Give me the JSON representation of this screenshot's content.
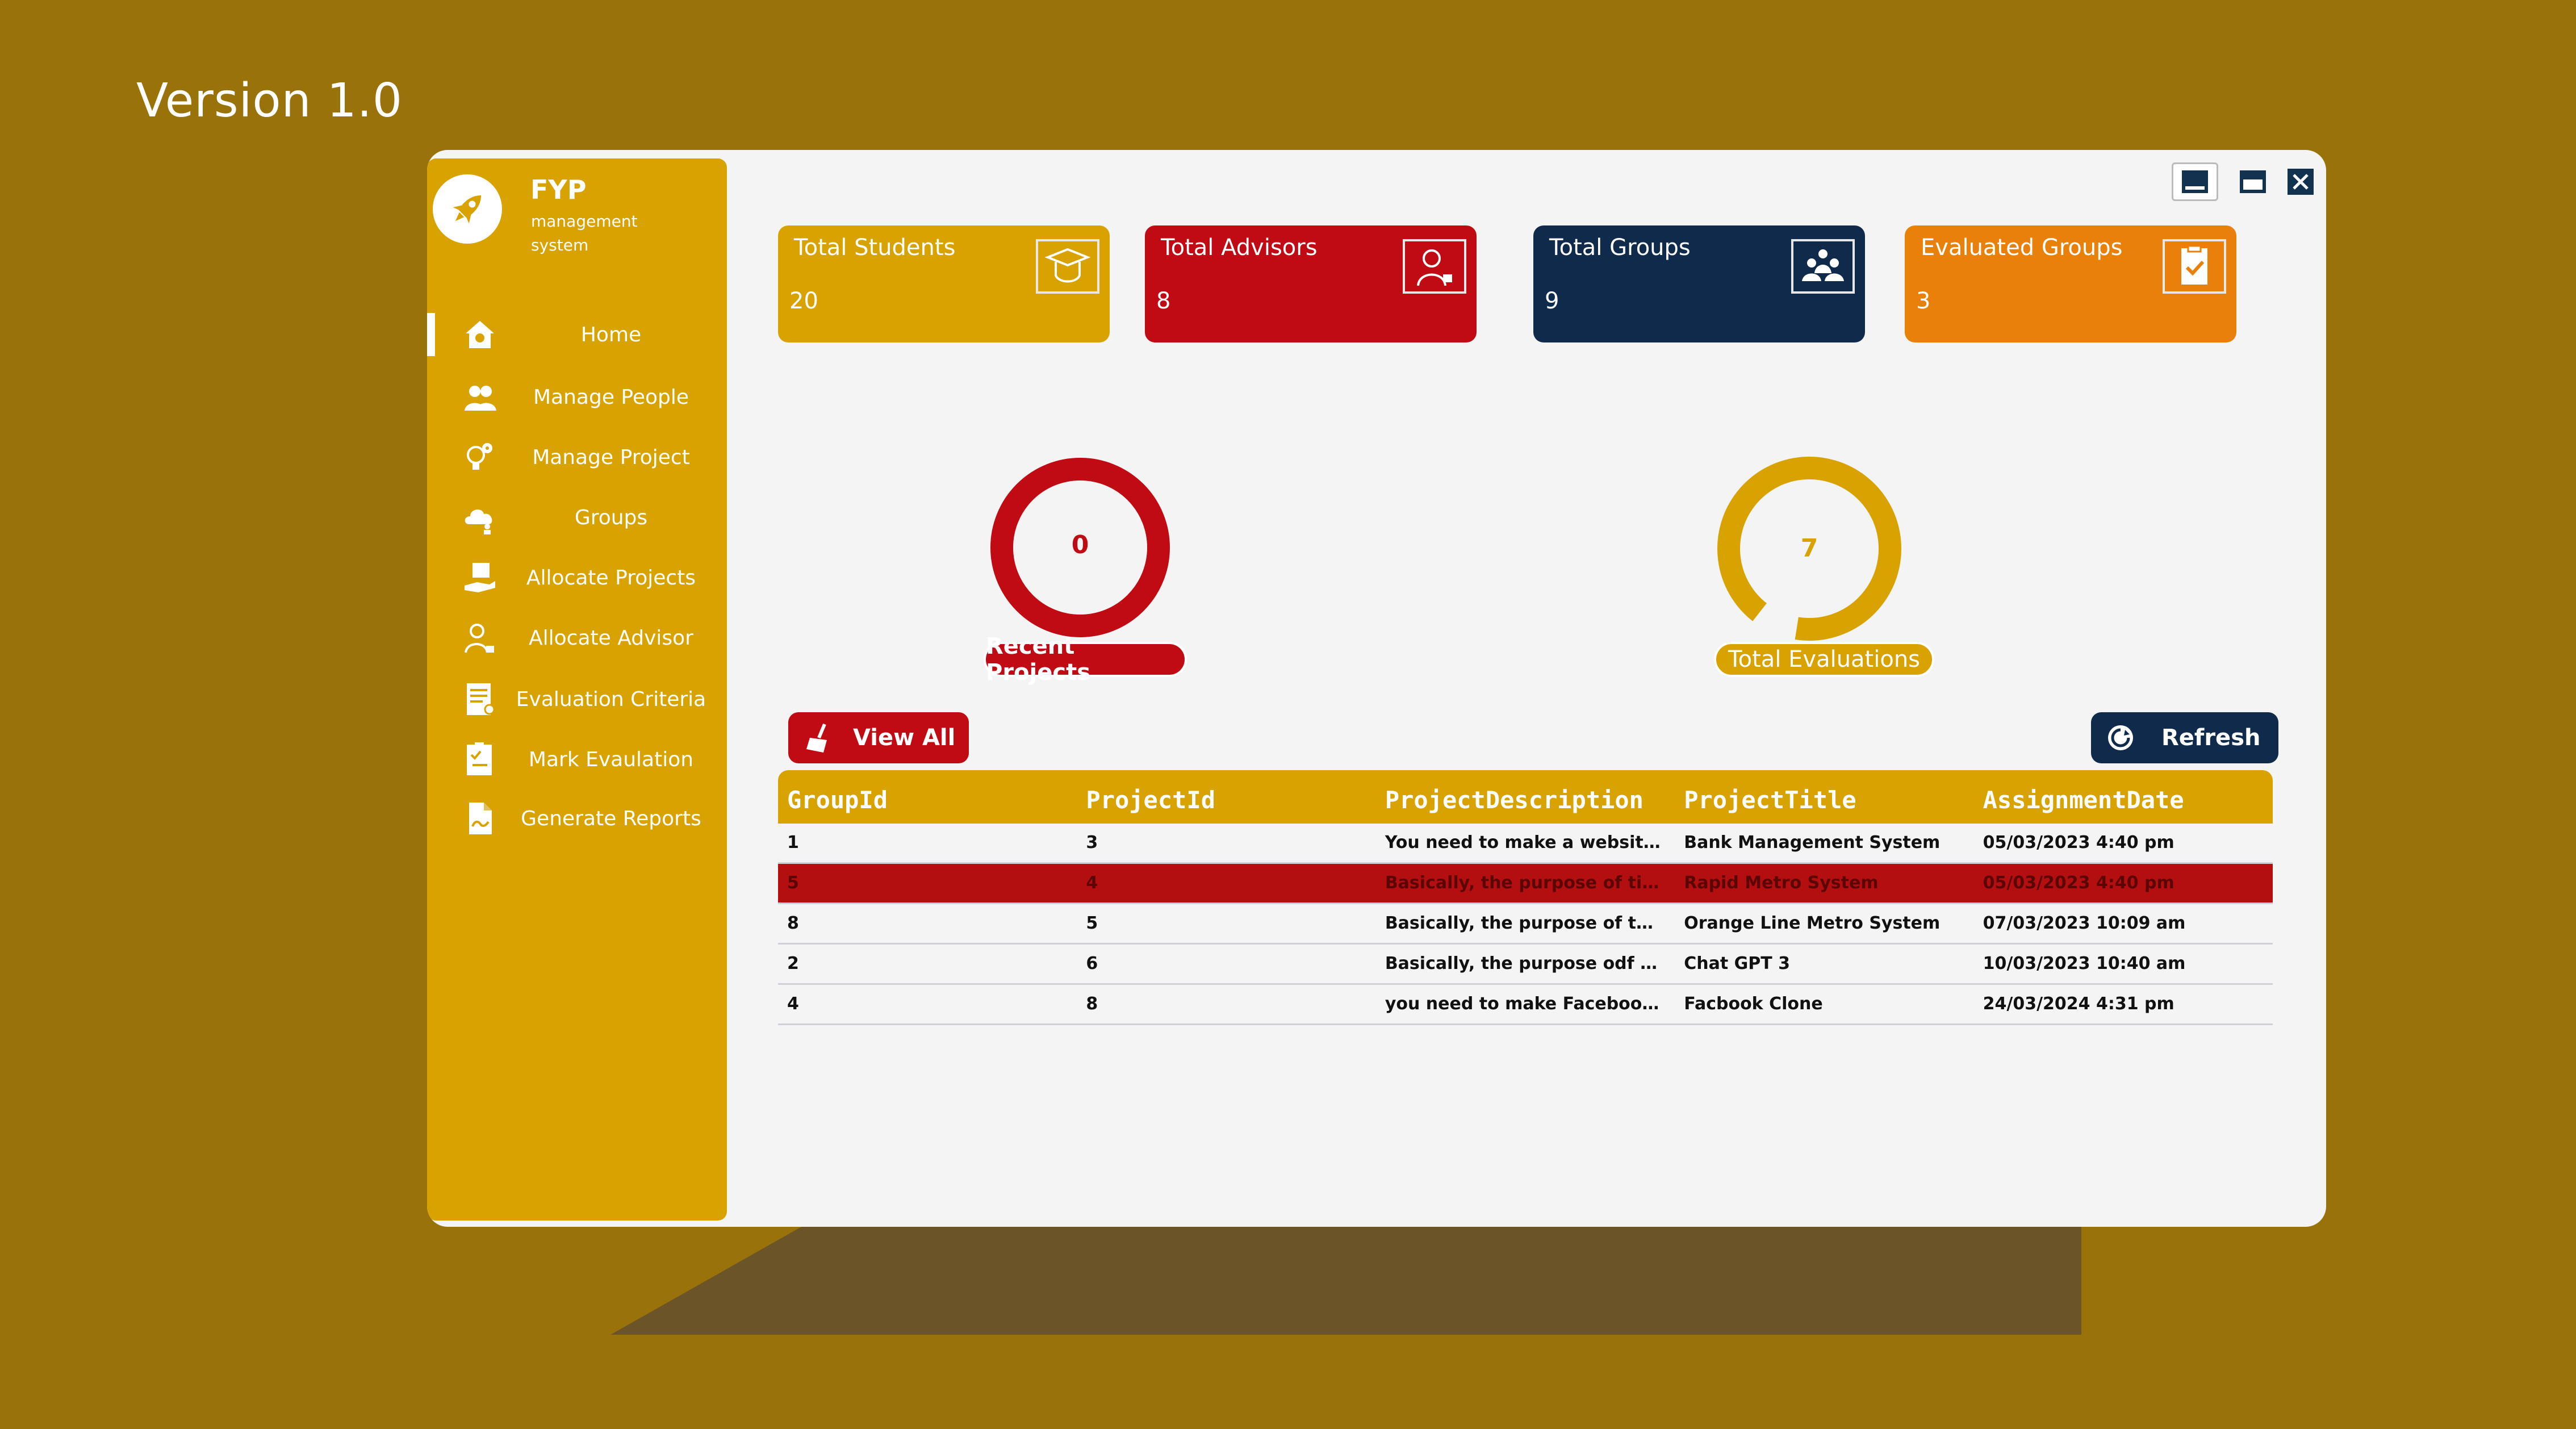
{
  "page": {
    "version_label": "Version 1.0"
  },
  "brand": {
    "title": "FYP",
    "subtitle": "management system"
  },
  "sidebar": {
    "items": [
      {
        "label": "Home",
        "icon": "home-icon",
        "active": true
      },
      {
        "label": "Manage People",
        "icon": "people-icon"
      },
      {
        "label": "Manage Project",
        "icon": "lightbulb-gear-icon"
      },
      {
        "label": "Groups",
        "icon": "cloud-group-icon"
      },
      {
        "label": "Allocate Projects",
        "icon": "hand-box-icon"
      },
      {
        "label": "Allocate Advisor",
        "icon": "advisor-lock-icon"
      },
      {
        "label": "Evaluation Criteria",
        "icon": "document-list-icon"
      },
      {
        "label": "Mark Evaulation",
        "icon": "checklist-icon"
      },
      {
        "label": "Generate Reports",
        "icon": "report-file-icon"
      }
    ]
  },
  "window_controls": {
    "icons": [
      "minimize-icon",
      "maximize-icon",
      "close-icon"
    ]
  },
  "cards": [
    {
      "title": "Total Students",
      "value": "20",
      "color": "#d8a300",
      "icon": "graduation-cap-icon"
    },
    {
      "title": "Total Advisors",
      "value": "8",
      "color": "#c00a14",
      "icon": "advisor-icon"
    },
    {
      "title": "Total Groups",
      "value": "9",
      "color": "#0f2a4a",
      "icon": "group-icon"
    },
    {
      "title": "Evaluated Groups",
      "value": "3",
      "color": "#e8800a",
      "icon": "clipboard-check-icon"
    }
  ],
  "rings": [
    {
      "label": "Recent Projects",
      "value": "0",
      "color": "#c00a14",
      "fraction": 0
    },
    {
      "label": "Total Evaluations",
      "value": "7",
      "color": "#d8a300",
      "fraction": 0.96
    }
  ],
  "buttons": {
    "view_all": "View All",
    "refresh": "Refresh"
  },
  "table": {
    "columns": [
      "GroupId",
      "ProjectId",
      "ProjectDescription",
      "ProjectTitle",
      "AssignmentDate"
    ],
    "rows": [
      [
        "1",
        "3",
        "You need to make a website for...",
        "Bank Management System",
        "05/03/2023 4:40 pm"
      ],
      [
        "5",
        "4",
        "Basically, the purpose of tis pro...",
        "Rapid Metro System",
        "05/03/2023 4:40 pm"
      ],
      [
        "8",
        "5",
        "Basically, the purpose of this pr...",
        "Orange Line Metro System",
        "07/03/2023 10:09 am"
      ],
      [
        "2",
        "6",
        "Basically, the purpose odf this p...",
        "Chat GPT 3",
        "10/03/2023 10:40 am"
      ],
      [
        "4",
        "8",
        "you need to make Facebook We...",
        "Facbook Clone",
        "24/03/2024 4:31 pm"
      ]
    ],
    "selected_row": 1
  },
  "colors": {
    "background": "#99720a",
    "sidebar": "#d8a300",
    "accent_red": "#c00a14",
    "navy": "#0f2a4a",
    "orange": "#e8800a"
  }
}
